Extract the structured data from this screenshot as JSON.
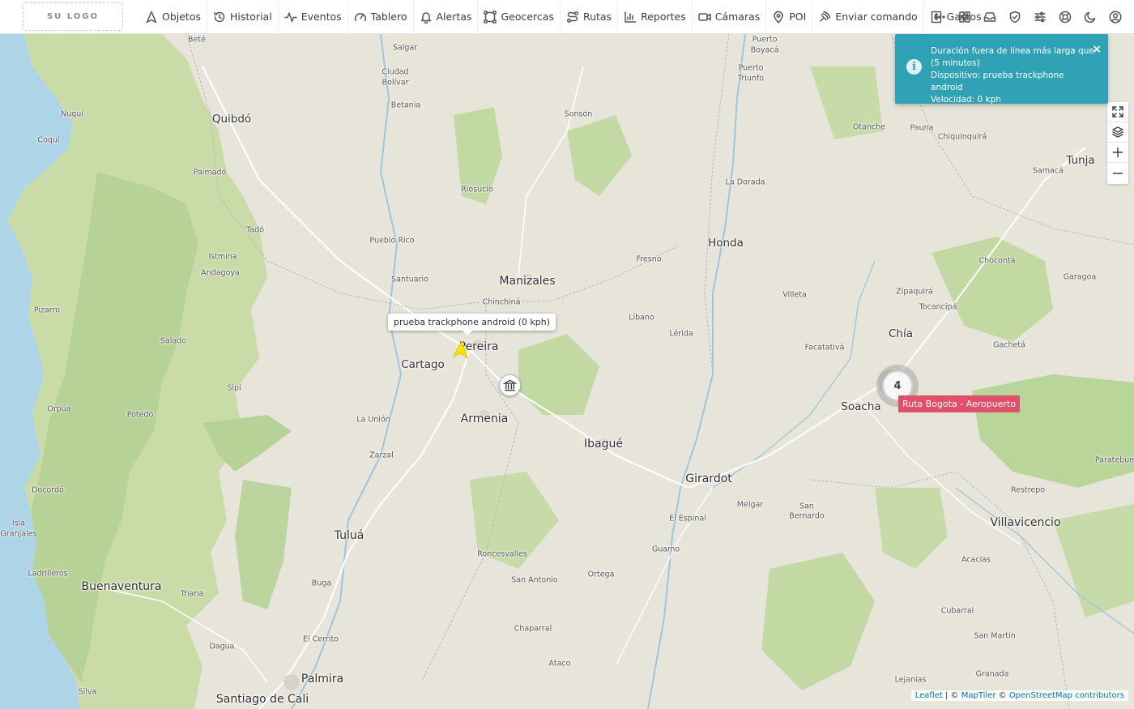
{
  "logo_text": "SU LOGO",
  "nav": [
    {
      "id": "objetos",
      "label": "Objetos",
      "icon": "navigation-icon"
    },
    {
      "id": "historial",
      "label": "Historial",
      "icon": "history-icon"
    },
    {
      "id": "eventos",
      "label": "Eventos",
      "icon": "activity-icon"
    },
    {
      "id": "tablero",
      "label": "Tablero",
      "icon": "gauge-icon"
    },
    {
      "id": "alertas",
      "label": "Alertas",
      "icon": "bell-icon"
    },
    {
      "id": "geocercas",
      "label": "Geocercas",
      "icon": "polygon-icon"
    },
    {
      "id": "rutas",
      "label": "Rutas",
      "icon": "route-icon"
    },
    {
      "id": "reportes",
      "label": "Reportes",
      "icon": "bar-chart-icon"
    },
    {
      "id": "camaras",
      "label": "Cámaras",
      "icon": "video-icon"
    },
    {
      "id": "poi",
      "label": "POI",
      "icon": "map-pin-icon"
    },
    {
      "id": "enviar-comando",
      "label": "Enviar comando",
      "icon": "satellite-icon"
    },
    {
      "id": "gastos",
      "label": "Gastos",
      "icon": "receipt-icon"
    }
  ],
  "notification": {
    "line1": "Duración fuera de línea más larga que",
    "line2": "(5 minutos)",
    "line3": "Dispositivo: prueba trackphone android",
    "line4": "Velocidad: 0 kph",
    "close": "×",
    "info": "i"
  },
  "device_tooltip": "prueba trackphone android (0 kph)",
  "cluster_count": "4",
  "route_label": "Ruta Bogota - Aeropuerto",
  "attribution": {
    "leaflet": "Leaflet",
    "sep": " | © ",
    "maptiler": "MapTiler",
    "sep2": " © ",
    "osm": "OpenStreetMap contributors"
  },
  "places": [
    {
      "n": "Beté",
      "s": "town"
    },
    {
      "n": "Salgar",
      "s": "town"
    },
    {
      "n": "Ciudad",
      "s": "town"
    },
    {
      "n": "Bolívar",
      "s": "town"
    },
    {
      "n": "Betania",
      "s": "town"
    },
    {
      "n": "Quibdó",
      "s": "city"
    },
    {
      "n": "Nuquí",
      "s": "town"
    },
    {
      "n": "Coquí",
      "s": "town"
    },
    {
      "n": "Sonsón",
      "s": "town"
    },
    {
      "n": "Puerto",
      "s": "town"
    },
    {
      "n": "Boyacá",
      "s": "town"
    },
    {
      "n": "Puerto",
      "s": "town"
    },
    {
      "n": "Triunfo",
      "s": "town"
    },
    {
      "n": "Otanche",
      "s": "town"
    },
    {
      "n": "Pauna",
      "s": "town"
    },
    {
      "n": "Chiquinquirá",
      "s": "town"
    },
    {
      "n": "Tunja",
      "s": "city"
    },
    {
      "n": "Samacá",
      "s": "town"
    },
    {
      "n": "Paimadó",
      "s": "town"
    },
    {
      "n": "Riosucio",
      "s": "town"
    },
    {
      "n": "La Dorada",
      "s": "town"
    },
    {
      "n": "Tadó",
      "s": "town"
    },
    {
      "n": "Pueblo Rico",
      "s": "town"
    },
    {
      "n": "Honda",
      "s": "city"
    },
    {
      "n": "Istmina",
      "s": "town"
    },
    {
      "n": "Andagoya",
      "s": "town"
    },
    {
      "n": "Fresno",
      "s": "town"
    },
    {
      "n": "Chocontá",
      "s": "town"
    },
    {
      "n": "Santuario",
      "s": "town"
    },
    {
      "n": "Manizales",
      "s": "bigcity"
    },
    {
      "n": "Garagoa",
      "s": "town"
    },
    {
      "n": "Chinchiná",
      "s": "town"
    },
    {
      "n": "Villeta",
      "s": "town"
    },
    {
      "n": "Zipaquirá",
      "s": "town"
    },
    {
      "n": "Pizarro",
      "s": "town"
    },
    {
      "n": "Líbano",
      "s": "town"
    },
    {
      "n": "Tocancipá",
      "s": "town"
    },
    {
      "n": "Chía",
      "s": "city"
    },
    {
      "n": "Salado",
      "s": "town"
    },
    {
      "n": "Lérida",
      "s": "town"
    },
    {
      "n": "Pereira",
      "s": "bigcity"
    },
    {
      "n": "Facatativá",
      "s": "town"
    },
    {
      "n": "Gachetá",
      "s": "town"
    },
    {
      "n": "Cartago",
      "s": "city"
    },
    {
      "n": "Sipí",
      "s": "town"
    },
    {
      "n": "Soacha",
      "s": "city"
    },
    {
      "n": "Orpúa",
      "s": "town"
    },
    {
      "n": "Potedo",
      "s": "town"
    },
    {
      "n": "La Unión",
      "s": "town"
    },
    {
      "n": "Armenia",
      "s": "bigcity"
    },
    {
      "n": "Ibagué",
      "s": "bigcity"
    },
    {
      "n": "Zarzal",
      "s": "town"
    },
    {
      "n": "Paratebue",
      "s": "town"
    },
    {
      "n": "Girardot",
      "s": "bigcity"
    },
    {
      "n": "Docordó",
      "s": "town"
    },
    {
      "n": "Restrepo",
      "s": "town"
    },
    {
      "n": "El Espinal",
      "s": "town"
    },
    {
      "n": "Melgar",
      "s": "town"
    },
    {
      "n": "San",
      "s": "town"
    },
    {
      "n": "Bernardo",
      "s": "town"
    },
    {
      "n": "Villavicencio",
      "s": "bigcity"
    },
    {
      "n": "Isla",
      "s": "town"
    },
    {
      "n": "Granjales",
      "s": "town"
    },
    {
      "n": "Tuluá",
      "s": "bigcity"
    },
    {
      "n": "Guamo",
      "s": "town"
    },
    {
      "n": "Roncesvalles",
      "s": "town"
    },
    {
      "n": "Acacías",
      "s": "town"
    },
    {
      "n": "Ladrilleros",
      "s": "town"
    },
    {
      "n": "Ortega",
      "s": "town"
    },
    {
      "n": "San Antonio",
      "s": "town"
    },
    {
      "n": "Buenaventura",
      "s": "bigcity"
    },
    {
      "n": "Buga",
      "s": "town"
    },
    {
      "n": "Triana",
      "s": "town"
    },
    {
      "n": "Cubarral",
      "s": "town"
    },
    {
      "n": "Chaparral",
      "s": "town"
    },
    {
      "n": "San Martín",
      "s": "town"
    },
    {
      "n": "Dagua",
      "s": "town"
    },
    {
      "n": "El Cerrito",
      "s": "town"
    },
    {
      "n": "Ataco",
      "s": "town"
    },
    {
      "n": "Granada",
      "s": "town"
    },
    {
      "n": "Palmira",
      "s": "bigcity"
    },
    {
      "n": "Lejanías",
      "s": "town"
    },
    {
      "n": "Silva",
      "s": "town"
    },
    {
      "n": "Santiago de Cali",
      "s": "bigcity"
    }
  ]
}
